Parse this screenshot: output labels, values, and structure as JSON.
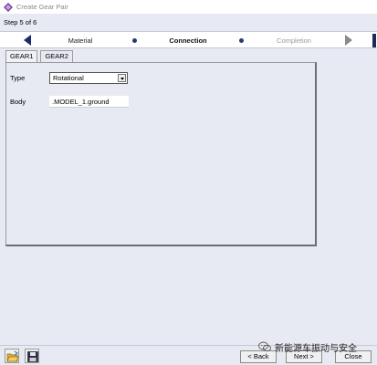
{
  "window": {
    "title": "Create Gear Pair"
  },
  "step": {
    "label": "Step 5 of 6"
  },
  "wizard": {
    "steps": [
      {
        "label": "Material",
        "state": "done"
      },
      {
        "label": "Connection",
        "state": "current"
      },
      {
        "label": "Completion",
        "state": "pending"
      }
    ]
  },
  "tabs": [
    {
      "label": "GEAR1",
      "active": true
    },
    {
      "label": "GEAR2",
      "active": false
    }
  ],
  "form": {
    "type_label": "Type",
    "type_value": "Rotational",
    "body_label": "Body",
    "body_value": ".MODEL_1.ground"
  },
  "buttons": {
    "back": "< Back",
    "next": "Next >",
    "close": "Close"
  },
  "watermark": {
    "text": "新能源车振动与安全"
  },
  "colors": {
    "accent": "#2a3a6a",
    "panel_bg": "#e8eaf3"
  }
}
